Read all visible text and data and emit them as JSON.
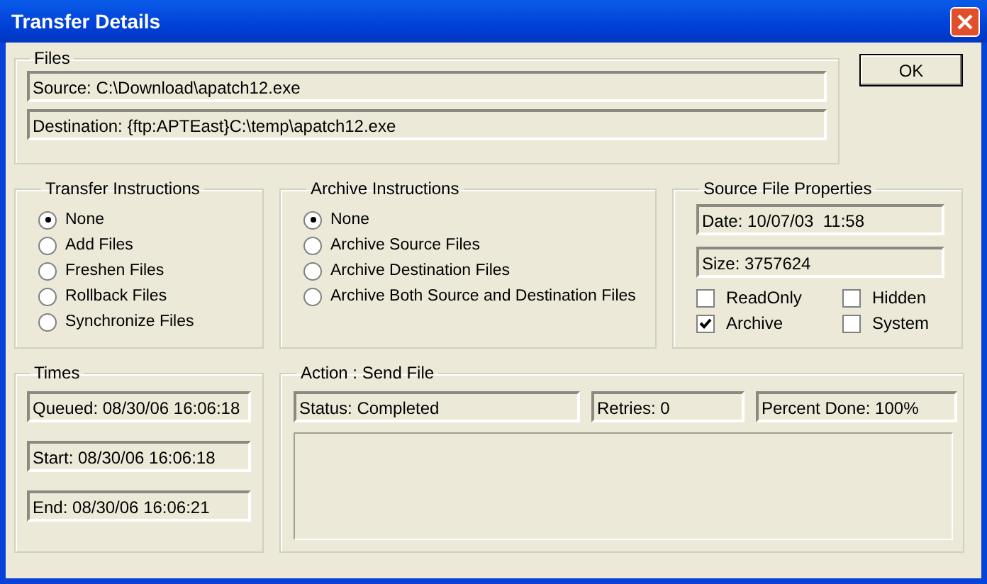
{
  "window": {
    "title": "Transfer Details"
  },
  "files": {
    "label": "Files",
    "fields": [
      "Source: C:\\Download\\apatch12.exe",
      "Destination: {ftp:APTEast}C:\\temp\\apatch12.exe"
    ]
  },
  "ok_button": "OK",
  "transfer_instructions": {
    "label": "Transfer Instructions",
    "options": [
      {
        "label": "None",
        "selected": true
      },
      {
        "label": "Add Files",
        "selected": false
      },
      {
        "label": "Freshen Files",
        "selected": false
      },
      {
        "label": "Rollback Files",
        "selected": false
      },
      {
        "label": "Synchronize Files",
        "selected": false
      }
    ]
  },
  "archive_instructions": {
    "label": "Archive Instructions",
    "options": [
      {
        "label": "None",
        "selected": true
      },
      {
        "label": "Archive Source Files",
        "selected": false
      },
      {
        "label": "Archive Destination Files",
        "selected": false
      },
      {
        "label": "Archive Both Source and Destination Files",
        "selected": false
      }
    ]
  },
  "source_file_properties": {
    "label": "Source File Properties",
    "fields": [
      "Date: 10/07/03  11:58",
      "Size: 3757624"
    ],
    "attributes": [
      {
        "label": "ReadOnly",
        "checked": false
      },
      {
        "label": "Hidden",
        "checked": false
      },
      {
        "label": "Archive",
        "checked": true
      },
      {
        "label": "System",
        "checked": false
      }
    ]
  },
  "times": {
    "label": "Times",
    "fields": [
      "Queued: 08/30/06 16:06:18",
      "Start: 08/30/06 16:06:18",
      "End: 08/30/06 16:06:21"
    ]
  },
  "action": {
    "label": "Action : Send File",
    "status": "Status: Completed",
    "retries": "Retries: 0",
    "percent_done": "Percent Done: 100%"
  }
}
